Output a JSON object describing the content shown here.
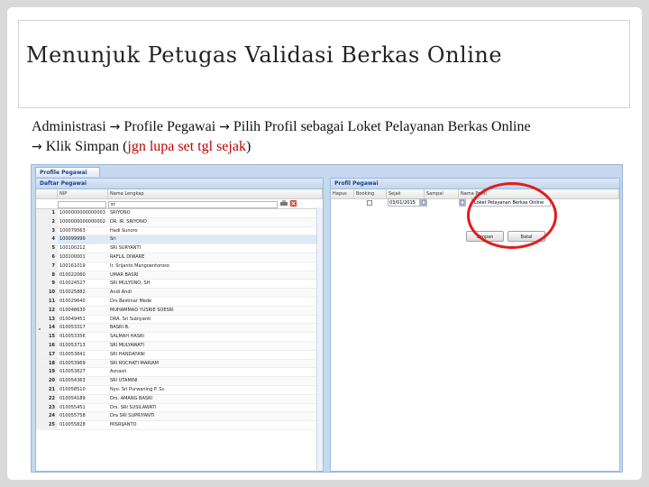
{
  "slide": {
    "title": "Menunjuk Petugas Validasi Berkas Online",
    "instruction": {
      "part1": "Administrasi",
      "part2": "Profile Pegawai",
      "part3": "Pilih Profil sebagai Loket Pelayanan Berkas Online",
      "part4": "Klik Simpan  (",
      "highlight": "jgn lupa set tgl sejak",
      "part5": ")"
    }
  },
  "app": {
    "tab_label": "Profile Pegawai",
    "left_panel": {
      "title": "Daftar Pegawai",
      "columns": {
        "nip": "NIP",
        "nama": "Nama Lengkap"
      },
      "filter_value": "sr",
      "rows": [
        {
          "num": "1",
          "nip": "1000000000000003",
          "nama": "SRIYONO"
        },
        {
          "num": "2",
          "nip": "1000000000000002",
          "nama": "DR. IR. SRIYONO"
        },
        {
          "num": "3",
          "nip": "100079563",
          "nama": "Hadi Sunoro"
        },
        {
          "num": "4",
          "nip": "100099999",
          "nama": "Sri"
        },
        {
          "num": "5",
          "nip": "100100212",
          "nama": "SRI SURYANTI"
        },
        {
          "num": "6",
          "nip": "100100001",
          "nama": "RAFLIL DIWARE"
        },
        {
          "num": "7",
          "nip": "100161019",
          "nama": "Ir. Srijanto Mangoentoroso"
        },
        {
          "num": "8",
          "nip": "010022060",
          "nama": "UMAR BASRI"
        },
        {
          "num": "9",
          "nip": "010024527",
          "nama": "SRI MULYONO, SH"
        },
        {
          "num": "10",
          "nip": "010025882",
          "nama": "Andi Andi"
        },
        {
          "num": "11",
          "nip": "010029640",
          "nama": "Drs Bestinar Mede"
        },
        {
          "num": "12",
          "nip": "010048630",
          "nama": "MUHAMMAD YUSRIE SOESRI"
        },
        {
          "num": "13",
          "nip": "010049451",
          "nama": "DRA. Sri Subiyanti"
        },
        {
          "num": "14",
          "nip": "010053317",
          "nama": "BASRI B."
        },
        {
          "num": "15",
          "nip": "010053356",
          "nama": "SALMAH HASRI"
        },
        {
          "num": "16",
          "nip": "010053713",
          "nama": "SRI MULYAWATI"
        },
        {
          "num": "17",
          "nip": "010053841",
          "nama": "SRI HANDAYANI"
        },
        {
          "num": "18",
          "nip": "010053969",
          "nama": "SRI ROCHATI MARIAM"
        },
        {
          "num": "19",
          "nip": "010053827",
          "nama": "Asnasri"
        },
        {
          "num": "20",
          "nip": "010054363",
          "nama": "SRI UTAMINI"
        },
        {
          "num": "21",
          "nip": "010058510",
          "nama": "Nyo. Sri Purwaning P. Sc."
        },
        {
          "num": "22",
          "nip": "010054189",
          "nama": "Drs. AMANG BASRI"
        },
        {
          "num": "23",
          "nip": "010055451",
          "nama": "Drs. SRI SUSILAWATI"
        },
        {
          "num": "24",
          "nip": "010055758",
          "nama": "Dra SRI SUPRIYANTI"
        },
        {
          "num": "25",
          "nip": "010055828",
          "nama": "MISRIJANTO"
        }
      ]
    },
    "right_panel": {
      "title": "Profil Pegawai",
      "columns": {
        "hapus": "Hapus",
        "booking": "Booking",
        "sejak": "Sejak",
        "sampai": "Sampai",
        "nama_profil": "Nama Profil"
      },
      "sejak_value": "03/01/2015",
      "profil_value": "Loket Pelayanan Berkas Online",
      "simpan_label": "Simpan",
      "batal_label": "Batal"
    }
  }
}
